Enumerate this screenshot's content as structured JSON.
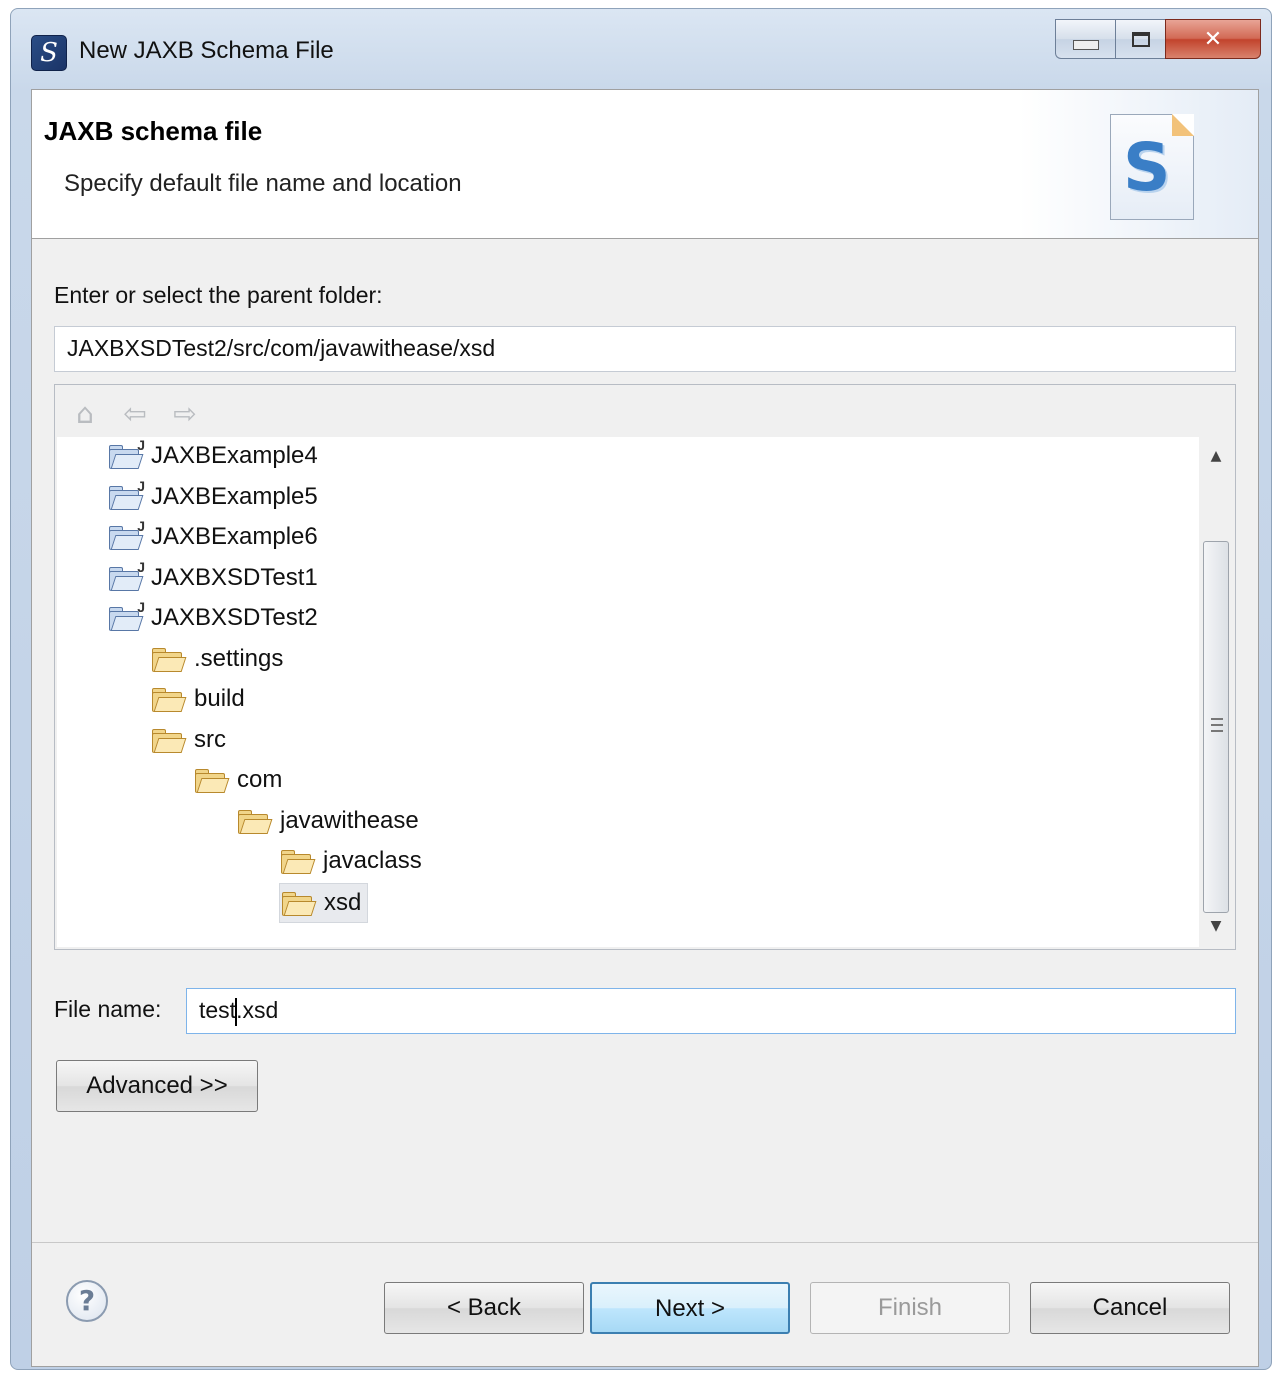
{
  "window": {
    "title": "New JAXB Schema File"
  },
  "banner": {
    "title": "JAXB schema file",
    "subtitle": "Specify default file name and location",
    "icon": "schema-s-icon"
  },
  "parent_folder": {
    "label": "Enter or select the parent folder:",
    "value": "JAXBXSDTest2/src/com/javawithease/xsd"
  },
  "tree_toolbar": [
    "home-icon",
    "back-arrow-icon",
    "forward-arrow-icon"
  ],
  "tree": {
    "items": [
      {
        "label": "JAXBExample4",
        "level": 0,
        "type": "project"
      },
      {
        "label": "JAXBExample5",
        "level": 0,
        "type": "project"
      },
      {
        "label": "JAXBExample6",
        "level": 0,
        "type": "project"
      },
      {
        "label": "JAXBXSDTest1",
        "level": 0,
        "type": "project"
      },
      {
        "label": "JAXBXSDTest2",
        "level": 0,
        "type": "project"
      },
      {
        "label": ".settings",
        "level": 1,
        "type": "folder"
      },
      {
        "label": "build",
        "level": 1,
        "type": "folder"
      },
      {
        "label": "src",
        "level": 1,
        "type": "folder"
      },
      {
        "label": "com",
        "level": 2,
        "type": "folder"
      },
      {
        "label": "javawithease",
        "level": 3,
        "type": "folder"
      },
      {
        "label": "javaclass",
        "level": 4,
        "type": "folder"
      },
      {
        "label": "xsd",
        "level": 4,
        "type": "folder",
        "selected": true
      }
    ]
  },
  "file_name": {
    "label": "File name:",
    "value_before_caret": "test",
    "value_after_caret": ".xsd"
  },
  "advanced_button": "Advanced >>",
  "footer": {
    "help_glyph": "?",
    "back": "< Back",
    "next": "Next >",
    "finish": "Finish",
    "cancel": "Cancel"
  }
}
